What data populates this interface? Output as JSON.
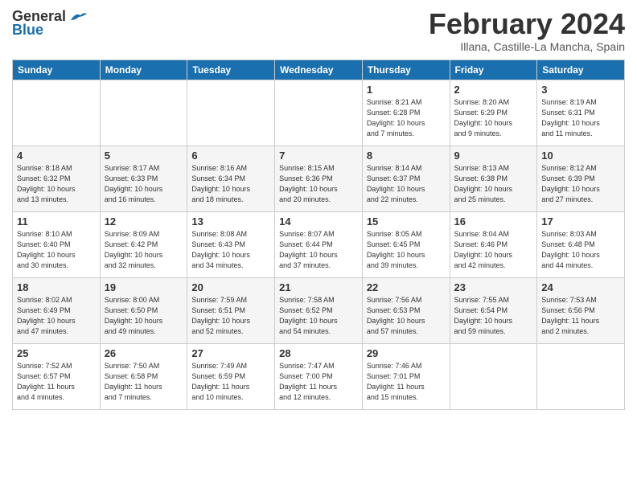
{
  "header": {
    "logo_general": "General",
    "logo_blue": "Blue",
    "month_title": "February 2024",
    "subtitle": "Illana, Castille-La Mancha, Spain"
  },
  "days_of_week": [
    "Sunday",
    "Monday",
    "Tuesday",
    "Wednesday",
    "Thursday",
    "Friday",
    "Saturday"
  ],
  "weeks": [
    [
      {
        "num": "",
        "info": ""
      },
      {
        "num": "",
        "info": ""
      },
      {
        "num": "",
        "info": ""
      },
      {
        "num": "",
        "info": ""
      },
      {
        "num": "1",
        "info": "Sunrise: 8:21 AM\nSunset: 6:28 PM\nDaylight: 10 hours\nand 7 minutes."
      },
      {
        "num": "2",
        "info": "Sunrise: 8:20 AM\nSunset: 6:29 PM\nDaylight: 10 hours\nand 9 minutes."
      },
      {
        "num": "3",
        "info": "Sunrise: 8:19 AM\nSunset: 6:31 PM\nDaylight: 10 hours\nand 11 minutes."
      }
    ],
    [
      {
        "num": "4",
        "info": "Sunrise: 8:18 AM\nSunset: 6:32 PM\nDaylight: 10 hours\nand 13 minutes."
      },
      {
        "num": "5",
        "info": "Sunrise: 8:17 AM\nSunset: 6:33 PM\nDaylight: 10 hours\nand 16 minutes."
      },
      {
        "num": "6",
        "info": "Sunrise: 8:16 AM\nSunset: 6:34 PM\nDaylight: 10 hours\nand 18 minutes."
      },
      {
        "num": "7",
        "info": "Sunrise: 8:15 AM\nSunset: 6:36 PM\nDaylight: 10 hours\nand 20 minutes."
      },
      {
        "num": "8",
        "info": "Sunrise: 8:14 AM\nSunset: 6:37 PM\nDaylight: 10 hours\nand 22 minutes."
      },
      {
        "num": "9",
        "info": "Sunrise: 8:13 AM\nSunset: 6:38 PM\nDaylight: 10 hours\nand 25 minutes."
      },
      {
        "num": "10",
        "info": "Sunrise: 8:12 AM\nSunset: 6:39 PM\nDaylight: 10 hours\nand 27 minutes."
      }
    ],
    [
      {
        "num": "11",
        "info": "Sunrise: 8:10 AM\nSunset: 6:40 PM\nDaylight: 10 hours\nand 30 minutes."
      },
      {
        "num": "12",
        "info": "Sunrise: 8:09 AM\nSunset: 6:42 PM\nDaylight: 10 hours\nand 32 minutes."
      },
      {
        "num": "13",
        "info": "Sunrise: 8:08 AM\nSunset: 6:43 PM\nDaylight: 10 hours\nand 34 minutes."
      },
      {
        "num": "14",
        "info": "Sunrise: 8:07 AM\nSunset: 6:44 PM\nDaylight: 10 hours\nand 37 minutes."
      },
      {
        "num": "15",
        "info": "Sunrise: 8:05 AM\nSunset: 6:45 PM\nDaylight: 10 hours\nand 39 minutes."
      },
      {
        "num": "16",
        "info": "Sunrise: 8:04 AM\nSunset: 6:46 PM\nDaylight: 10 hours\nand 42 minutes."
      },
      {
        "num": "17",
        "info": "Sunrise: 8:03 AM\nSunset: 6:48 PM\nDaylight: 10 hours\nand 44 minutes."
      }
    ],
    [
      {
        "num": "18",
        "info": "Sunrise: 8:02 AM\nSunset: 6:49 PM\nDaylight: 10 hours\nand 47 minutes."
      },
      {
        "num": "19",
        "info": "Sunrise: 8:00 AM\nSunset: 6:50 PM\nDaylight: 10 hours\nand 49 minutes."
      },
      {
        "num": "20",
        "info": "Sunrise: 7:59 AM\nSunset: 6:51 PM\nDaylight: 10 hours\nand 52 minutes."
      },
      {
        "num": "21",
        "info": "Sunrise: 7:58 AM\nSunset: 6:52 PM\nDaylight: 10 hours\nand 54 minutes."
      },
      {
        "num": "22",
        "info": "Sunrise: 7:56 AM\nSunset: 6:53 PM\nDaylight: 10 hours\nand 57 minutes."
      },
      {
        "num": "23",
        "info": "Sunrise: 7:55 AM\nSunset: 6:54 PM\nDaylight: 10 hours\nand 59 minutes."
      },
      {
        "num": "24",
        "info": "Sunrise: 7:53 AM\nSunset: 6:56 PM\nDaylight: 11 hours\nand 2 minutes."
      }
    ],
    [
      {
        "num": "25",
        "info": "Sunrise: 7:52 AM\nSunset: 6:57 PM\nDaylight: 11 hours\nand 4 minutes."
      },
      {
        "num": "26",
        "info": "Sunrise: 7:50 AM\nSunset: 6:58 PM\nDaylight: 11 hours\nand 7 minutes."
      },
      {
        "num": "27",
        "info": "Sunrise: 7:49 AM\nSunset: 6:59 PM\nDaylight: 11 hours\nand 10 minutes."
      },
      {
        "num": "28",
        "info": "Sunrise: 7:47 AM\nSunset: 7:00 PM\nDaylight: 11 hours\nand 12 minutes."
      },
      {
        "num": "29",
        "info": "Sunrise: 7:46 AM\nSunset: 7:01 PM\nDaylight: 11 hours\nand 15 minutes."
      },
      {
        "num": "",
        "info": ""
      },
      {
        "num": "",
        "info": ""
      }
    ]
  ]
}
